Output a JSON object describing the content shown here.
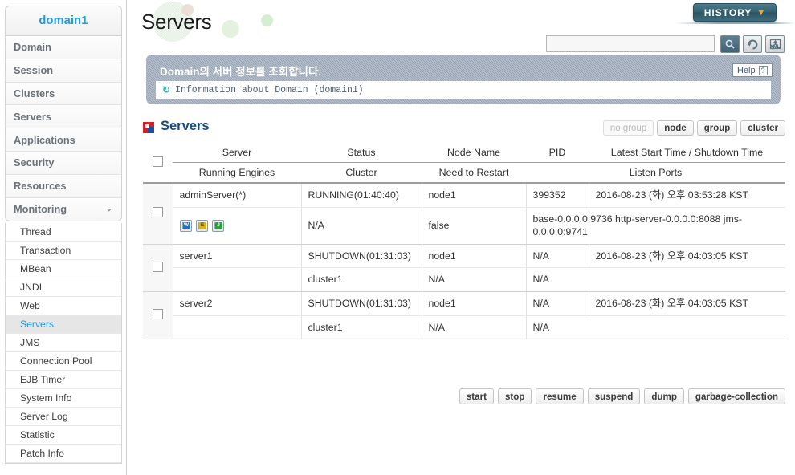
{
  "sidebar": {
    "domain_label": "domain1",
    "main_items": [
      {
        "label": "Domain"
      },
      {
        "label": "Session"
      },
      {
        "label": "Clusters"
      },
      {
        "label": "Servers"
      },
      {
        "label": "Applications"
      },
      {
        "label": "Security"
      },
      {
        "label": "Resources"
      },
      {
        "label": "Monitoring",
        "chevron": "⌄"
      }
    ],
    "sub_items": [
      {
        "label": "Thread",
        "active": false
      },
      {
        "label": "Transaction",
        "active": false
      },
      {
        "label": "MBean",
        "active": false
      },
      {
        "label": "JNDI",
        "active": false
      },
      {
        "label": "Web",
        "active": false
      },
      {
        "label": "Servers",
        "active": true
      },
      {
        "label": "JMS",
        "active": false
      },
      {
        "label": "Connection Pool",
        "active": false
      },
      {
        "label": "EJB Timer",
        "active": false
      },
      {
        "label": "System Info",
        "active": false
      },
      {
        "label": "Server Log",
        "active": false
      },
      {
        "label": "Statistic",
        "active": false
      },
      {
        "label": "Patch Info",
        "active": false
      }
    ]
  },
  "header": {
    "page_title": "Servers",
    "history_label": "HISTORY",
    "history_arrow": "▼",
    "search_value": "",
    "search_placeholder": "",
    "icons": {
      "search": "search-icon",
      "refresh": "refresh-icon",
      "xml": "xml-export-icon",
      "xml_label": "XML"
    }
  },
  "banner": {
    "title": "Domain의 서버 정보를 조회합니다.",
    "info_icon": "↻",
    "info_text": "Information about Domain (domain1)",
    "help_label": "Help",
    "help_mark": "?"
  },
  "section": {
    "title": "Servers",
    "group_buttons": [
      {
        "label": "no group",
        "disabled": true
      },
      {
        "label": "node",
        "disabled": false
      },
      {
        "label": "group",
        "disabled": false
      },
      {
        "label": "cluster",
        "disabled": false
      }
    ]
  },
  "table": {
    "headers_row1": [
      "Server",
      "Status",
      "Node Name",
      "PID",
      "Latest Start Time / Shutdown Time"
    ],
    "headers_row2": [
      "Running Engines",
      "Cluster",
      "Need to Restart",
      "Listen Ports"
    ],
    "rows": [
      {
        "server": "adminServer(*)",
        "status": "RUNNING(01:40:40)",
        "node_name": "node1",
        "pid": "399352",
        "latest_time": "2016-08-23 (화) 오후 03:53:28 KST",
        "engines": [
          {
            "badge": "W",
            "kind": "w"
          },
          {
            "badge": "E",
            "kind": "e"
          },
          {
            "badge": "J",
            "kind": "j"
          }
        ],
        "cluster": "N/A",
        "need_restart": "false",
        "listen_ports": "base-0.0.0.0:9736  http-server-0.0.0.0:8088  jms-0.0.0.0:9741"
      },
      {
        "server": "server1",
        "status": "SHUTDOWN(01:31:03)",
        "node_name": "node1",
        "pid": "N/A",
        "latest_time": "2016-08-23 (화) 오후 04:03:05 KST",
        "engines": [],
        "cluster": "cluster1",
        "need_restart": "N/A",
        "listen_ports_col": "N/A",
        "listen_ports": ""
      },
      {
        "server": "server2",
        "status": "SHUTDOWN(01:31:03)",
        "node_name": "node1",
        "pid": "N/A",
        "latest_time": "2016-08-23 (화) 오후 04:03:05 KST",
        "engines": [],
        "cluster": "cluster1",
        "need_restart": "N/A",
        "listen_ports_col": "N/A",
        "listen_ports": ""
      }
    ]
  },
  "actions": [
    {
      "label": "start"
    },
    {
      "label": "stop"
    },
    {
      "label": "resume"
    },
    {
      "label": "suspend"
    },
    {
      "label": "dump"
    },
    {
      "label": "garbage-collection"
    }
  ],
  "colors": {
    "brand_blue": "#1b9ae0",
    "section_title": "#144b8a",
    "banner_bg": "#9aa6b5",
    "history_btn": "#34606f",
    "accent_orange": "#f5a623"
  }
}
